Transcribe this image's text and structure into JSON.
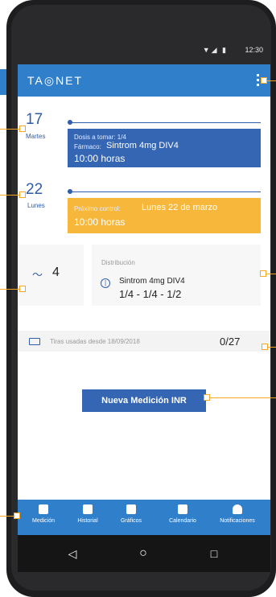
{
  "status": {
    "signal": "▼◢ ▮",
    "time": "12:30"
  },
  "app": {
    "logo": "TA◎NET"
  },
  "schedule": {
    "today": {
      "day": "17",
      "weekday": "Martes",
      "dose_label": "Dosis a tomar: 1/4",
      "drug_prefix": "Fármaco:",
      "drug": "Sintrom 4mg DIV4",
      "time": "10:00 horas",
      "accent": "#3466b4"
    },
    "next": {
      "day": "22",
      "weekday": "Lunes",
      "label": "Próximo control:",
      "date": "Lunes 22 de marzo",
      "time": "10:00 horas",
      "accent": "#f6b73a"
    }
  },
  "inr": {
    "value": "4"
  },
  "distribution": {
    "label": "Distribución",
    "drug": "Sintrom 4mg DIV4",
    "values": "1/4 - 1/4 - 1/2"
  },
  "strips": {
    "label": "Tiras usadas desde 18/09/2018",
    "value": "0/27"
  },
  "cta": {
    "label": "Nueva Medición INR"
  },
  "tabs": [
    {
      "label": "Medición",
      "icon": "check-icon"
    },
    {
      "label": "Historial",
      "icon": "list-icon"
    },
    {
      "label": "Gráficos",
      "icon": "bar-chart-icon"
    },
    {
      "label": "Calendario",
      "icon": "calendar-icon"
    },
    {
      "label": "Notificaciones",
      "icon": "bell-icon"
    }
  ],
  "nav": {
    "back": "◁",
    "home": "○",
    "recent": "□"
  },
  "colors": {
    "primary": "#2f7fcb",
    "secondary": "#3466b4",
    "warning": "#f6b73a",
    "callout": "#f5a623"
  }
}
